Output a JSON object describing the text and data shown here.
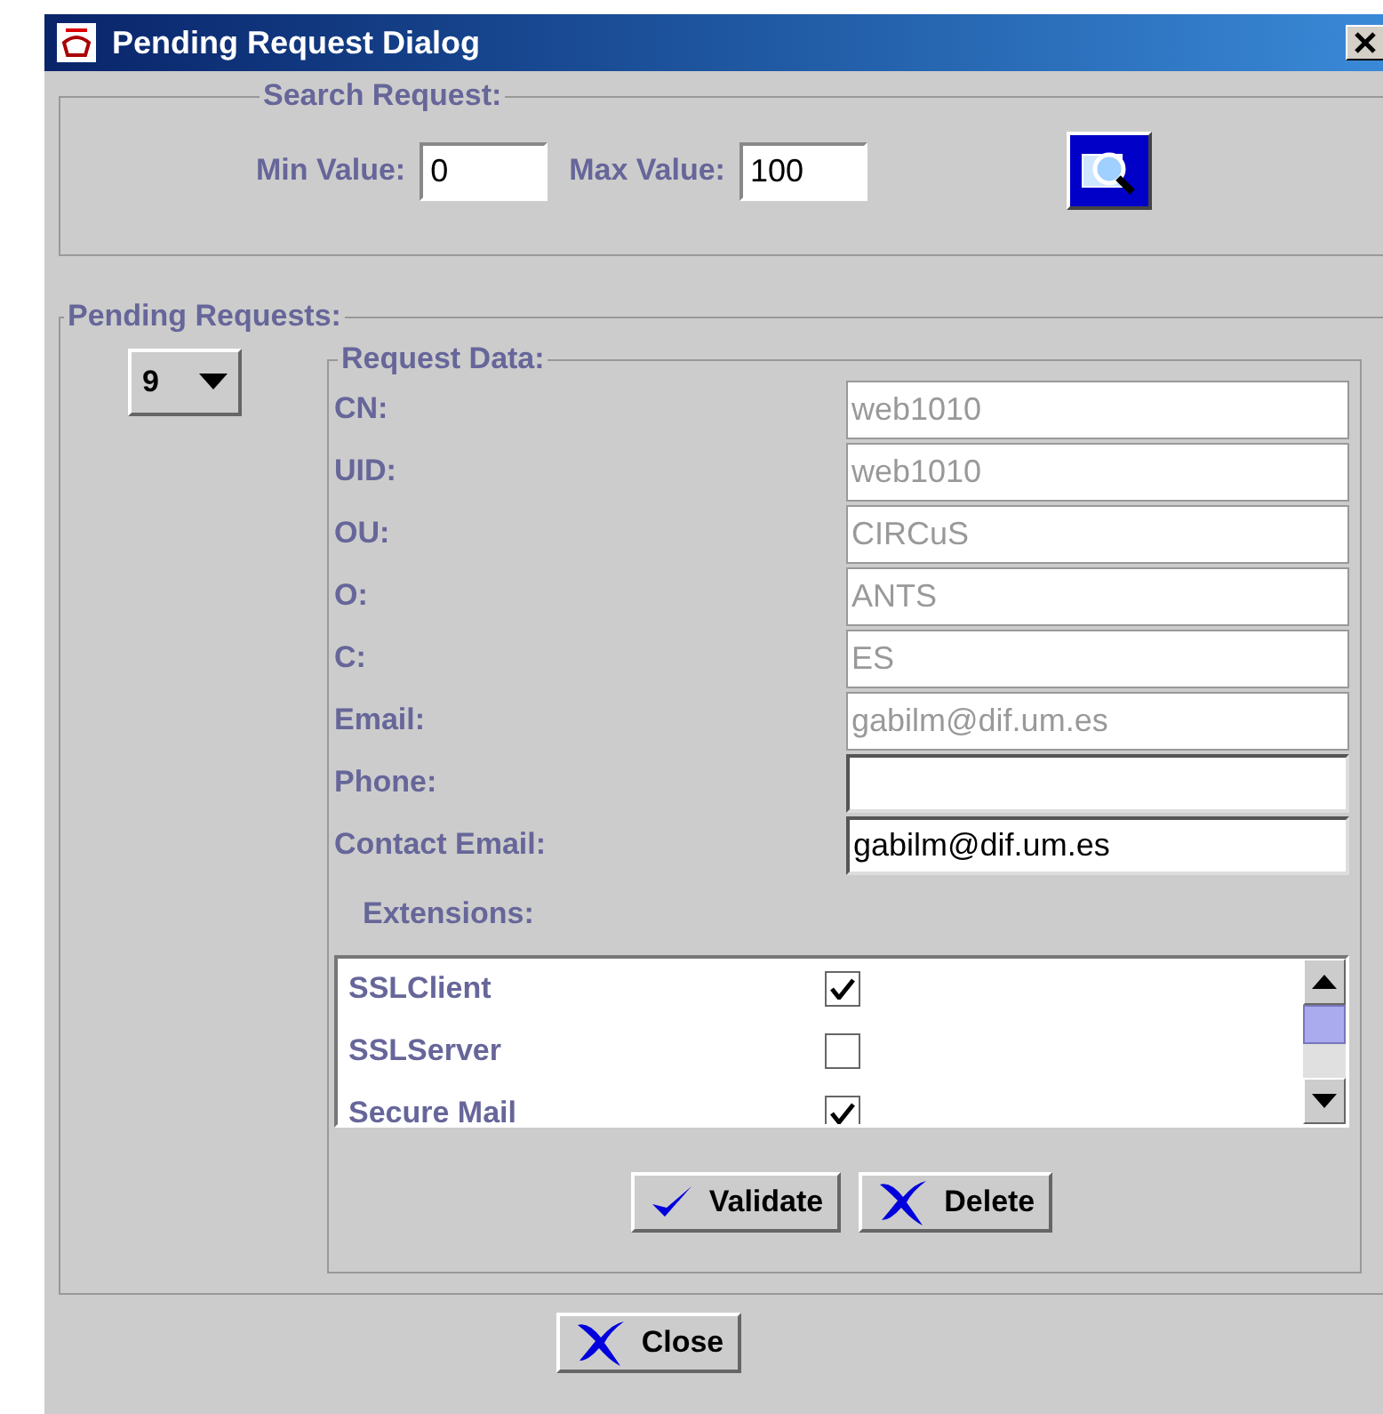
{
  "window": {
    "title": "Pending Request Dialog"
  },
  "search": {
    "title": "Search Request:",
    "min_label": "Min Value:",
    "min_value": "0",
    "max_label": "Max Value:",
    "max_value": "100"
  },
  "pending": {
    "title": "Pending Requests:",
    "selector": "9",
    "request_data": {
      "title": "Request Data:",
      "fields": [
        {
          "label": "CN:",
          "value": "web1010",
          "disabled": true
        },
        {
          "label": "UID:",
          "value": "web1010",
          "disabled": true
        },
        {
          "label": "OU:",
          "value": "CIRCuS",
          "disabled": true
        },
        {
          "label": "O:",
          "value": "ANTS",
          "disabled": true
        },
        {
          "label": "C:",
          "value": "ES",
          "disabled": true
        },
        {
          "label": "Email:",
          "value": "gabilm@dif.um.es",
          "disabled": true
        },
        {
          "label": "Phone:",
          "disabled": false
        },
        {
          "label": "Contact Email:",
          "value": "gabilm@dif.um.es",
          "disabled": false
        }
      ],
      "extensions_label": "Extensions:",
      "extensions": [
        {
          "label": "SSLClient",
          "checked": true
        },
        {
          "label": "SSLServer",
          "checked": false
        },
        {
          "label": "Secure Mail",
          "checked": true
        }
      ],
      "buttons": [
        {
          "kind": "validate",
          "label": "Validate"
        },
        {
          "kind": "delete",
          "label": "Delete"
        }
      ]
    }
  },
  "footer": {
    "buttons": [
      {
        "kind": "delete",
        "label": "Close"
      }
    ]
  }
}
